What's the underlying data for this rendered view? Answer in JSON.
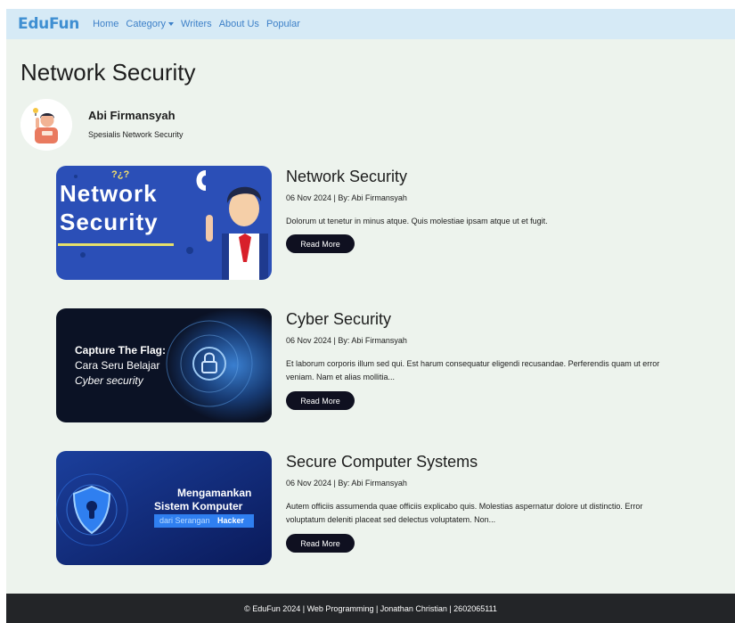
{
  "nav": {
    "brand": "EduFun",
    "links": [
      "Home",
      "Category",
      "Writers",
      "About Us",
      "Popular"
    ]
  },
  "page": {
    "title": "Network Security",
    "author": {
      "name": "Abi Firmansyah",
      "role": "Spesialis Network Security"
    }
  },
  "articles": [
    {
      "title": "Network Security",
      "meta": "06 Nov 2024 | By: Abi Firmansyah",
      "excerpt": "Dolorum ut tenetur in minus atque. Quis molestiae ipsam atque ut et fugit.",
      "button": "Read More",
      "image": {
        "line1": "Network",
        "line2": "Security",
        "mark": "?¿?"
      }
    },
    {
      "title": "Cyber Security",
      "meta": "06 Nov 2024 | By: Abi Firmansyah",
      "excerpt": "Et laborum corporis illum sed qui. Est harum consequatur eligendi recusandae. Perferendis quam ut error veniam. Nam et alias mollitia...",
      "button": "Read More",
      "image": {
        "line1": "Capture The Flag:",
        "line2": "Cara Seru Belajar",
        "line3": "Cyber security"
      }
    },
    {
      "title": "Secure Computer Systems",
      "meta": "06 Nov 2024 | By: Abi Firmansyah",
      "excerpt": "Autem officiis assumenda quae officiis explicabo quis. Molestias aspernatur dolore ut distinctio. Error voluptatum deleniti placeat sed delectus voluptatem. Non...",
      "button": "Read More",
      "image": {
        "line1": "Mengamankan",
        "line2": "Sistem Komputer",
        "line3": "dari Serangan",
        "line4": "Hacker"
      }
    }
  ],
  "footer": {
    "text": "© EduFun 2024 | Web Programming | Jonathan Christian | 2602065111"
  },
  "colors": {
    "brand": "#3f8fd2",
    "navbar": "#d6eaf6",
    "page_background": "#edf3ed",
    "button": "#0f1020",
    "footer": "#232528"
  }
}
